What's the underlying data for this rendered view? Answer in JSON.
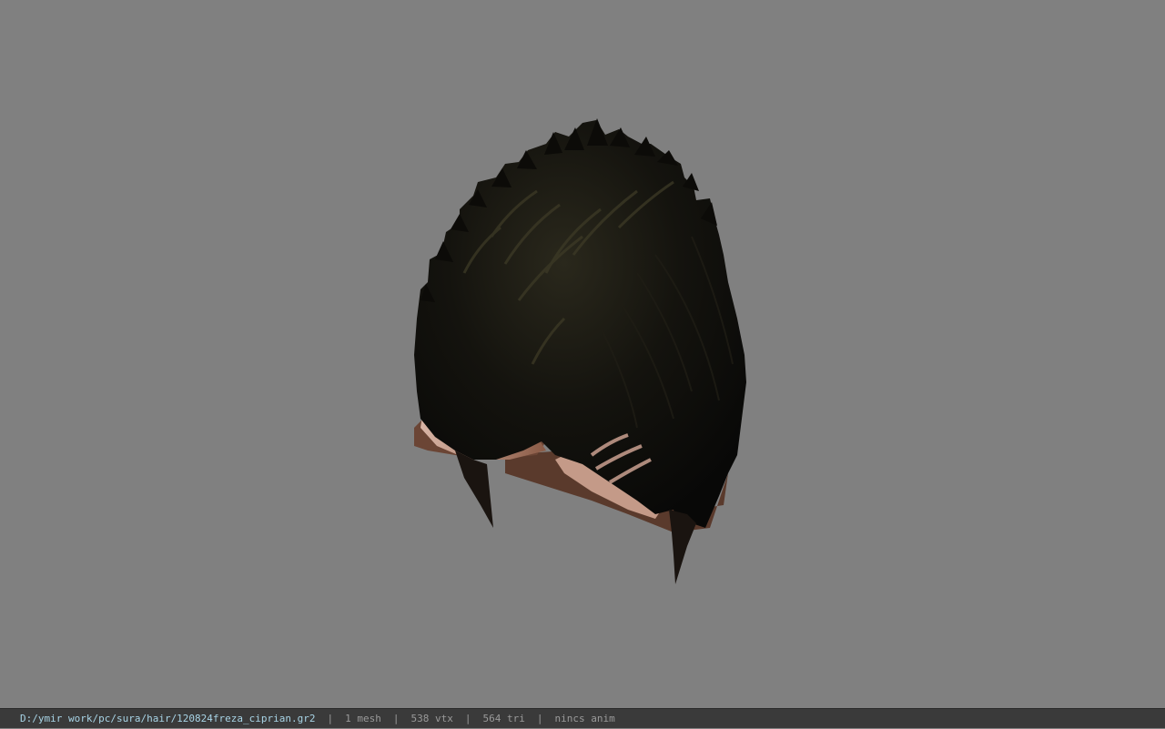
{
  "viewer": {
    "background_color": "#808080",
    "model": {
      "description": "hair-mesh",
      "colors": {
        "hair": "#0e0d0a",
        "hair_highlight": "#4a4530",
        "skin": "#d9b5a6",
        "skin_shadow": "#6b4030"
      }
    }
  },
  "status_bar": {
    "file_path": "D:/ymir work/pc/sura/hair/120824freza_ciprian.gr2",
    "separator": "|",
    "mesh_count": "1 mesh",
    "vertex_count": "538 vtx",
    "triangle_count": "564 tri",
    "anim_status": "nincs anim"
  }
}
